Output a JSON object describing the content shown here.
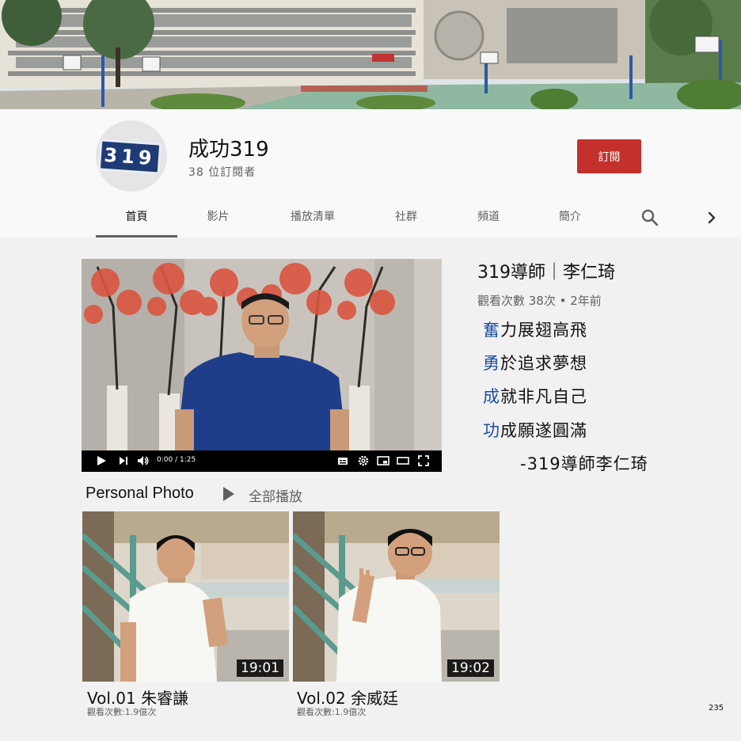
{
  "channel": {
    "avatar_text": "319",
    "name": "成功319",
    "subscribers": "38 位訂閱者",
    "subscribe_label": "訂閱"
  },
  "tabs": [
    {
      "label": "首頁",
      "active": true
    },
    {
      "label": "影片"
    },
    {
      "label": "播放清單"
    },
    {
      "label": "社群"
    },
    {
      "label": "頻道"
    },
    {
      "label": "簡介"
    }
  ],
  "icons": {
    "search": "search-icon",
    "more": "chevron-right-icon",
    "play": "play-icon",
    "next": "next-icon",
    "volume": "volume-icon",
    "captions": "captions-icon",
    "settings": "gear-icon",
    "miniplayer": "miniplayer-icon",
    "theater": "theater-icon",
    "fullscreen": "fullscreen-icon"
  },
  "player": {
    "time": "0:00 / 1:25"
  },
  "featured": {
    "title": "319導師｜李仁琦",
    "meta": "觀看次數 38次 • 2年前",
    "lines": [
      {
        "first": "奮",
        "rest": "力展翅高飛"
      },
      {
        "first": "勇",
        "rest": "於追求夢想"
      },
      {
        "first": "成",
        "rest": "就非凡自己"
      },
      {
        "first": "功",
        "rest": "成願遂圓滿"
      }
    ],
    "signature": "-319導師李仁琦"
  },
  "playlist": {
    "title": "Personal Photo",
    "play_all": "全部播放",
    "videos": [
      {
        "duration": "19:01",
        "title": "Vol.01 朱睿謙",
        "views": "觀看次數:1.9億次"
      },
      {
        "duration": "19:02",
        "title": "Vol.02 余威廷",
        "views": "觀看次數:1.9億次"
      }
    ]
  },
  "colors": {
    "subscribe": "#c4302b",
    "accent_text": "#1b4da3",
    "background": "#f1f1f1",
    "header": "#f9f9f9"
  },
  "page_number": "235"
}
